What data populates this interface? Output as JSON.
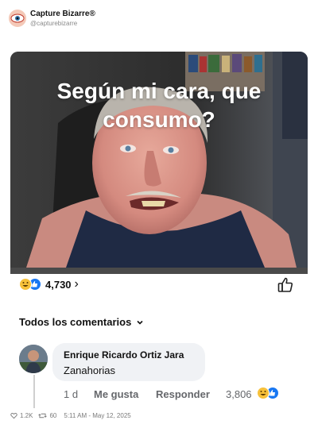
{
  "account": {
    "name": "Capture Bizarre®",
    "handle": "@capturebizarre",
    "logo_icon": "eye-logo-icon"
  },
  "post": {
    "meme_line_1": "Según mi cara, que",
    "meme_line_2": "consumo?",
    "reactions_count": "4,730",
    "reaction_icons": [
      "haha-emoji-icon",
      "like-reaction-icon"
    ]
  },
  "comments_section": {
    "header_label": "Todos los comentarios"
  },
  "comment": {
    "author": "Enrique Ricardo Ortiz Jara",
    "text": "Zanahorias",
    "time": "1 d",
    "like_label": "Me gusta",
    "reply_label": "Responder",
    "reactions_count": "3,806"
  },
  "footer": {
    "likes": "1.2K",
    "retweets": "60",
    "timestamp": "5:11 AM - May 12, 2025"
  },
  "colors": {
    "facebook_blue": "#1877f2",
    "haha_yellow": "#f7c13a",
    "bubble_grey": "#f0f2f5"
  }
}
